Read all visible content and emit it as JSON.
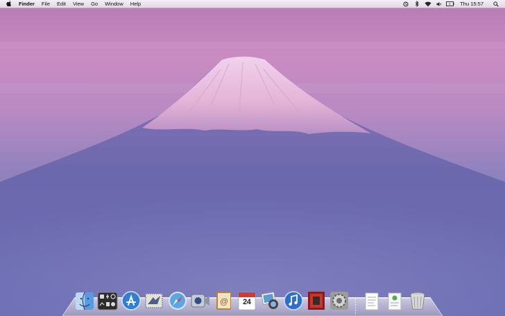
{
  "menubar": {
    "apple_icon": "apple-logo-icon",
    "app_name": "Finder",
    "items": [
      "File",
      "Edit",
      "View",
      "Go",
      "Window",
      "Help"
    ],
    "status_icons": [
      "time-machine-icon",
      "bluetooth-icon",
      "wifi-icon",
      "volume-icon",
      "battery-icon"
    ],
    "clock": "Thu 15:57",
    "search_icon": "spotlight-icon"
  },
  "desktop": {
    "wallpaper": "mount-fuji-twilight",
    "sky_color": "#c98fc0",
    "mountain_color": "#6f6aae"
  },
  "dock": {
    "apps": [
      "Finder",
      "Dashboard",
      "App Store",
      "Mail",
      "Safari",
      "FaceTime",
      "Address Book",
      "iCal",
      "iPhoto",
      "iTunes",
      "Photo Booth",
      "System Preferences"
    ],
    "ical_day": "24",
    "stacks": [
      "Documents",
      "Downloads"
    ],
    "trash": "Trash"
  }
}
